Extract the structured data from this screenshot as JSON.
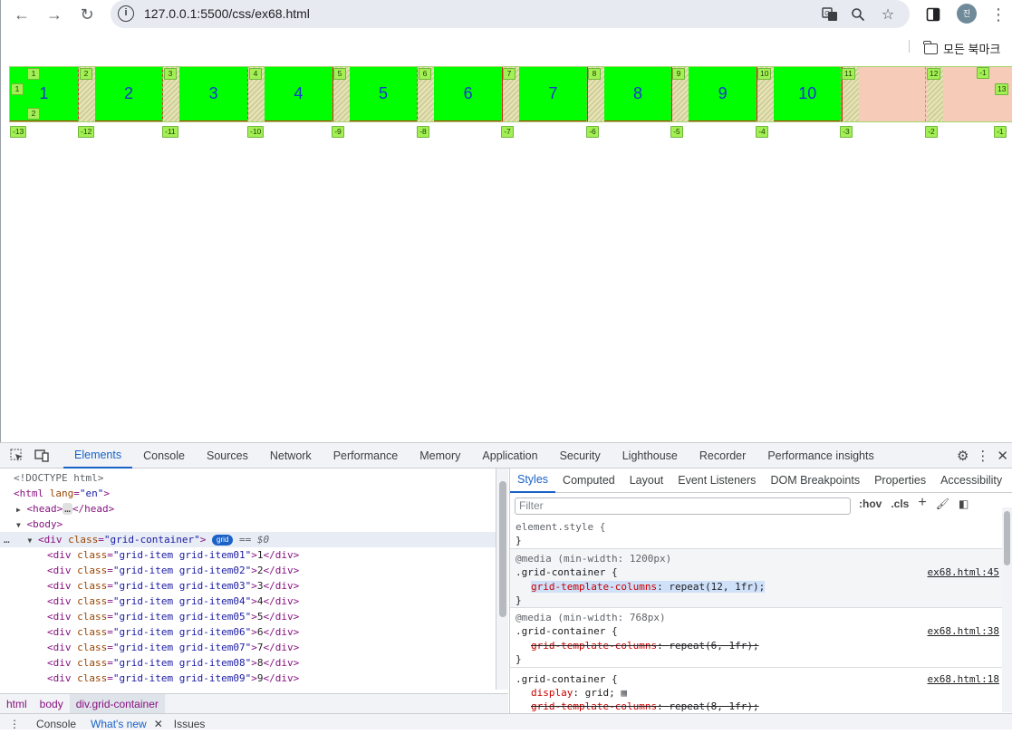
{
  "browser": {
    "url": "127.0.0.1:5500/css/ex68.html",
    "bookmark_folder": "모든 북마크",
    "avatar_initial": "진"
  },
  "page": {
    "grid_items": [
      "1",
      "2",
      "3",
      "4",
      "5",
      "6",
      "7",
      "8",
      "9",
      "10"
    ],
    "positive_line_numbers": [
      "1",
      "2",
      "3",
      "4",
      "5",
      "6",
      "7",
      "8",
      "9",
      "10",
      "11",
      "12",
      "13"
    ],
    "row_line_numbers": [
      "1",
      "2"
    ],
    "negative_line_numbers": [
      "-13",
      "-12",
      "-11",
      "-10",
      "-9",
      "-8",
      "-7",
      "-6",
      "-5",
      "-4",
      "-3",
      "-2",
      "-1"
    ],
    "top_right_neg": "-1"
  },
  "devtools": {
    "tabs": [
      "Elements",
      "Console",
      "Sources",
      "Network",
      "Performance",
      "Memory",
      "Application",
      "Security",
      "Lighthouse",
      "Recorder",
      "Performance insights"
    ],
    "active_tab": "Elements",
    "dom_lines": {
      "doctype": "<!DOCTYPE html>",
      "html_open": "<html",
      "html_attr": " lang",
      "html_val": "\"en\"",
      "head_open": "<head>",
      "head_close": "</head>",
      "body": "<body>",
      "grid_div_tag": "<div",
      "grid_div_attr": " class",
      "grid_div_val": "\"grid-container\"",
      "grid_badge": "grid",
      "eq_ref": "== $0",
      "items": [
        {
          "cls": "\"grid-item grid-item01\"",
          "text": "1"
        },
        {
          "cls": "\"grid-item grid-item02\"",
          "text": "2"
        },
        {
          "cls": "\"grid-item grid-item03\"",
          "text": "3"
        },
        {
          "cls": "\"grid-item grid-item04\"",
          "text": "4"
        },
        {
          "cls": "\"grid-item grid-item05\"",
          "text": "5"
        },
        {
          "cls": "\"grid-item grid-item06\"",
          "text": "6"
        },
        {
          "cls": "\"grid-item grid-item07\"",
          "text": "7"
        },
        {
          "cls": "\"grid-item grid-item08\"",
          "text": "8"
        },
        {
          "cls": "\"grid-item grid-item09\"",
          "text": "9"
        }
      ]
    },
    "breadcrumbs": [
      "html",
      "body",
      "div.grid-container"
    ],
    "styles_tabs": [
      "Styles",
      "Computed",
      "Layout",
      "Event Listeners",
      "DOM Breakpoints",
      "Properties",
      "Accessibility"
    ],
    "filter_placeholder": "Filter",
    "hov": ":hov",
    "cls": ".cls",
    "rules": {
      "element_style": "element.style {",
      "close": "}",
      "r1_media": "@media (min-width: 1200px)",
      "r1_selector": ".grid-container {",
      "r1_src": "ex68.html:45",
      "r1_prop": "grid-template-columns",
      "r1_val": "repeat(12, 1fr);",
      "r2_media": "@media (min-width: 768px)",
      "r2_selector": ".grid-container {",
      "r2_src": "ex68.html:38",
      "r2_prop": "grid-template-columns",
      "r2_val": "repeat(6, 1fr);",
      "r3_selector": ".grid-container {",
      "r3_src": "ex68.html:18",
      "r3_prop1": "display",
      "r3_val1": "grid;",
      "r3_prop2": "grid-template-columns",
      "r3_val2": "repeat(8, 1fr);"
    },
    "drawer_tabs": [
      "Console",
      "What's new",
      "Issues"
    ]
  }
}
